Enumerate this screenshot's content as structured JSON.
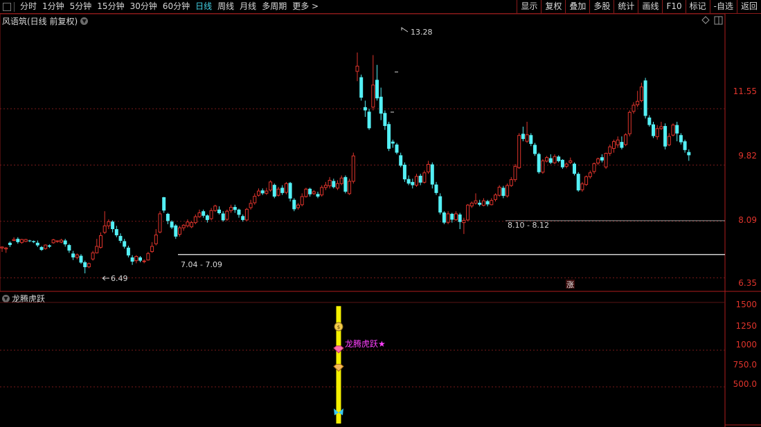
{
  "toolbar": {
    "periods": [
      "分时",
      "1分钟",
      "5分钟",
      "15分钟",
      "30分钟",
      "60分钟",
      "日线",
      "周线",
      "月线",
      "多周期",
      "更多 >"
    ],
    "active_period": "日线",
    "right_buttons": [
      "显示",
      "复权",
      "叠加",
      "多股",
      "统计",
      "画线",
      "F10",
      "标记",
      "-自选",
      "返回"
    ]
  },
  "main_panel": {
    "title": "风语筑(日线 前复权)",
    "axis_labels": [
      "11.55",
      "9.82",
      "8.09",
      "6.35"
    ],
    "annotations": {
      "high": "13.28",
      "low": "6.49",
      "support_left": "7.04 - 7.09",
      "support_right": "8.10 - 8.12",
      "zhang_marker": "涨"
    }
  },
  "indicator_panel": {
    "title": "龙腾虎跃",
    "axis_labels": [
      "1500",
      "1250",
      "1000",
      "750.0",
      "500.0"
    ],
    "signal_label": "龙腾虎跃★"
  },
  "colors": {
    "up": "#e0342c",
    "down": "#54f0f5",
    "background": "#000000",
    "grid": "#7a1a1a",
    "indicator_bar": "#f5f000",
    "signal_text": "#ff40ff"
  },
  "chart_data": {
    "type": "candlestick",
    "ylim": [
      6.0,
      14.0
    ],
    "candles": [
      [
        7.27,
        7.3,
        7.32,
        7.15
      ],
      [
        7.24,
        7.27,
        7.3,
        7.12
      ],
      [
        7.43,
        7.36,
        7.47,
        7.3
      ],
      [
        7.5,
        7.53,
        7.6,
        7.48
      ],
      [
        7.55,
        7.45,
        7.6,
        7.4
      ],
      [
        7.44,
        7.53,
        7.55,
        7.4
      ],
      [
        7.47,
        7.53,
        7.55,
        7.45
      ],
      [
        7.5,
        7.49,
        7.52,
        7.45
      ],
      [
        7.48,
        7.45,
        7.5,
        7.42
      ],
      [
        7.43,
        7.35,
        7.5,
        7.3
      ],
      [
        7.3,
        7.21,
        7.33,
        7.18
      ],
      [
        7.25,
        7.36,
        7.38,
        7.22
      ],
      [
        7.35,
        7.31,
        7.38,
        7.27
      ],
      [
        7.43,
        7.52,
        7.55,
        7.4
      ],
      [
        7.47,
        7.49,
        7.5,
        7.43
      ],
      [
        7.45,
        7.51,
        7.55,
        7.42
      ],
      [
        7.5,
        7.38,
        7.55,
        7.31
      ],
      [
        7.36,
        7.19,
        7.4,
        7.12
      ],
      [
        7.1,
        6.98,
        7.18,
        6.9
      ],
      [
        6.98,
        7.06,
        7.1,
        6.92
      ],
      [
        7.03,
        6.82,
        7.08,
        6.78
      ],
      [
        6.83,
        6.68,
        6.88,
        6.49
      ],
      [
        6.69,
        6.79,
        6.82,
        6.65
      ],
      [
        6.93,
        7.12,
        7.18,
        6.88
      ],
      [
        7.12,
        7.32,
        7.55,
        7.1
      ],
      [
        7.29,
        7.65,
        7.75,
        7.25
      ],
      [
        7.75,
        7.95,
        8.4,
        7.7
      ],
      [
        7.95,
        8.08,
        8.15,
        7.85
      ],
      [
        8.08,
        7.85,
        8.12,
        7.75
      ],
      [
        7.85,
        7.66,
        7.95,
        7.6
      ],
      [
        7.64,
        7.49,
        7.72,
        7.42
      ],
      [
        7.48,
        7.31,
        7.55,
        7.25
      ],
      [
        7.28,
        7.04,
        7.34,
        6.98
      ],
      [
        6.98,
        6.85,
        7.05,
        6.75
      ],
      [
        6.88,
        7.01,
        7.05,
        6.8
      ],
      [
        6.98,
        6.88,
        7.02,
        6.83
      ],
      [
        6.86,
        6.87,
        6.92,
        6.8
      ],
      [
        6.9,
        7.1,
        7.15,
        6.88
      ],
      [
        7.16,
        7.32,
        7.45,
        7.12
      ],
      [
        7.4,
        7.67,
        7.85,
        7.35
      ],
      [
        7.76,
        8.32,
        8.4,
        7.72
      ],
      [
        8.83,
        8.42,
        8.84,
        8.35
      ],
      [
        8.32,
        8.1,
        8.35,
        8.0
      ],
      [
        8.08,
        7.9,
        8.12,
        7.85
      ],
      [
        7.96,
        7.62,
        8.0,
        7.55
      ],
      [
        7.69,
        7.89,
        7.95,
        7.62
      ],
      [
        7.89,
        7.97,
        8.0,
        7.8
      ],
      [
        7.95,
        8.07,
        8.15,
        7.9
      ],
      [
        7.92,
        8.05,
        8.1,
        7.88
      ],
      [
        8.05,
        8.23,
        8.3,
        8.0
      ],
      [
        8.23,
        8.35,
        8.45,
        8.2
      ],
      [
        8.4,
        8.26,
        8.45,
        8.2
      ],
      [
        8.27,
        8.13,
        8.3,
        8.05
      ],
      [
        8.17,
        8.42,
        8.5,
        8.12
      ],
      [
        8.42,
        8.56,
        8.6,
        8.38
      ],
      [
        8.45,
        8.34,
        8.55,
        8.3
      ],
      [
        8.33,
        8.12,
        8.4,
        8.08
      ],
      [
        8.15,
        8.4,
        8.45,
        8.1
      ],
      [
        8.42,
        8.52,
        8.6,
        8.35
      ],
      [
        8.53,
        8.44,
        8.6,
        8.35
      ],
      [
        8.45,
        8.29,
        8.48,
        8.2
      ],
      [
        8.25,
        8.13,
        8.3,
        8.08
      ],
      [
        8.13,
        8.46,
        8.5,
        8.1
      ],
      [
        8.51,
        8.64,
        8.75,
        8.45
      ],
      [
        8.66,
        8.86,
        8.95,
        8.6
      ],
      [
        8.89,
        9.02,
        9.1,
        8.85
      ],
      [
        9.04,
        8.95,
        9.1,
        8.9
      ],
      [
        8.95,
        9.02,
        9.12,
        8.9
      ],
      [
        9.05,
        9.3,
        9.35,
        9.0
      ],
      [
        9.21,
        8.85,
        9.25,
        8.8
      ],
      [
        8.89,
        9.08,
        9.15,
        8.85
      ],
      [
        9.12,
        8.96,
        9.2,
        8.9
      ],
      [
        8.98,
        9.25,
        9.3,
        8.92
      ],
      [
        9.27,
        8.79,
        9.3,
        8.7
      ],
      [
        8.75,
        8.46,
        8.8,
        8.4
      ],
      [
        8.51,
        8.59,
        8.65,
        8.45
      ],
      [
        8.6,
        8.85,
        8.95,
        8.55
      ],
      [
        8.85,
        9.08,
        9.12,
        8.82
      ],
      [
        9.09,
        8.92,
        9.12,
        8.85
      ],
      [
        8.94,
        9.0,
        9.05,
        8.9
      ],
      [
        8.93,
        8.85,
        9.0,
        8.8
      ],
      [
        8.9,
        9.13,
        9.2,
        8.85
      ],
      [
        9.13,
        9.2,
        9.3,
        9.05
      ],
      [
        9.18,
        9.35,
        9.45,
        9.1
      ],
      [
        9.33,
        9.14,
        9.4,
        9.1
      ],
      [
        9.11,
        9.25,
        9.35,
        9.05
      ],
      [
        9.25,
        9.42,
        9.5,
        9.2
      ],
      [
        9.45,
        9.0,
        9.5,
        8.95
      ],
      [
        8.94,
        9.32,
        9.4,
        8.9
      ],
      [
        9.32,
        10.1,
        10.2,
        9.25
      ],
      [
        12.7,
        12.86,
        13.28,
        12.4
      ],
      [
        12.52,
        11.89,
        12.6,
        11.8
      ],
      [
        11.6,
        11.5,
        11.8,
        11.3
      ],
      [
        11.46,
        10.95,
        11.55,
        10.9
      ],
      [
        11.6,
        12.28,
        13.2,
        11.5
      ],
      [
        12.44,
        11.87,
        12.9,
        11.8
      ],
      [
        11.92,
        11.4,
        12.2,
        11.2
      ],
      [
        11.42,
        11.02,
        11.5,
        10.9
      ],
      [
        11.08,
        10.32,
        11.15,
        10.25
      ],
      [
        10.54,
        10.48,
        10.6,
        10.35
      ],
      [
        10.45,
        10.2,
        10.5,
        10.15
      ],
      [
        10.12,
        9.8,
        10.2,
        9.75
      ],
      [
        9.83,
        9.38,
        9.9,
        9.3
      ],
      [
        9.39,
        9.25,
        9.5,
        9.2
      ],
      [
        9.3,
        9.2,
        9.4,
        9.1
      ],
      [
        9.2,
        9.47,
        9.55,
        9.15
      ],
      [
        9.49,
        9.28,
        9.55,
        9.2
      ],
      [
        9.29,
        9.58,
        9.65,
        9.25
      ],
      [
        9.61,
        9.84,
        9.95,
        9.55
      ],
      [
        9.84,
        9.22,
        9.9,
        9.1
      ],
      [
        9.22,
        8.96,
        9.3,
        8.9
      ],
      [
        8.86,
        8.36,
        8.95,
        8.3
      ],
      [
        8.36,
        8.05,
        8.4,
        8.0
      ],
      [
        8.06,
        8.32,
        8.4,
        8.0
      ],
      [
        8.32,
        8.14,
        8.35,
        8.05
      ],
      [
        8.14,
        8.32,
        8.4,
        8.1
      ],
      [
        8.3,
        8.07,
        8.35,
        7.85
      ],
      [
        8.05,
        8.12,
        8.2,
        7.7
      ],
      [
        8.13,
        8.59,
        8.62,
        8.1
      ],
      [
        8.56,
        8.65,
        8.7,
        8.5
      ],
      [
        8.65,
        8.72,
        8.95,
        8.6
      ],
      [
        8.66,
        8.6,
        8.75,
        8.55
      ],
      [
        8.58,
        8.72,
        8.8,
        8.55
      ],
      [
        8.71,
        8.61,
        8.75,
        8.55
      ],
      [
        8.6,
        8.73,
        8.8,
        8.58
      ],
      [
        8.76,
        8.9,
        8.95,
        8.7
      ],
      [
        8.89,
        9.14,
        9.2,
        8.85
      ],
      [
        9.12,
        8.87,
        9.18,
        8.8
      ],
      [
        8.87,
        9.19,
        9.25,
        8.82
      ],
      [
        9.19,
        9.37,
        9.45,
        9.15
      ],
      [
        9.37,
        9.78,
        9.85,
        9.3
      ],
      [
        9.74,
        10.73,
        10.8,
        9.7
      ],
      [
        10.78,
        10.62,
        11.0,
        10.55
      ],
      [
        10.55,
        10.75,
        11.15,
        10.5
      ],
      [
        10.74,
        10.47,
        10.8,
        10.4
      ],
      [
        10.44,
        10.16,
        10.5,
        10.1
      ],
      [
        10.16,
        9.6,
        10.2,
        9.55
      ],
      [
        9.6,
        9.95,
        10.0,
        9.55
      ],
      [
        9.94,
        10.05,
        10.1,
        9.9
      ],
      [
        10.03,
        9.89,
        10.15,
        9.85
      ],
      [
        9.89,
        10.08,
        10.15,
        9.85
      ],
      [
        10.08,
        9.94,
        10.12,
        9.9
      ],
      [
        9.98,
        9.75,
        10.0,
        9.7
      ],
      [
        9.78,
        9.85,
        9.9,
        9.72
      ],
      [
        9.9,
        9.95,
        10.05,
        9.85
      ],
      [
        9.86,
        9.55,
        9.9,
        9.5
      ],
      [
        9.55,
        9.04,
        9.6,
        9.0
      ],
      [
        9.06,
        9.24,
        9.3,
        9.0
      ],
      [
        9.22,
        9.46,
        9.5,
        9.18
      ],
      [
        9.46,
        9.58,
        9.65,
        9.4
      ],
      [
        9.62,
        9.86,
        9.9,
        9.55
      ],
      [
        9.88,
        10.01,
        10.05,
        9.82
      ],
      [
        10.06,
        9.96,
        10.15,
        9.9
      ],
      [
        9.76,
        10.18,
        10.2,
        9.7
      ],
      [
        10.18,
        10.38,
        10.45,
        10.1
      ],
      [
        10.33,
        10.54,
        10.6,
        10.2
      ],
      [
        10.44,
        10.59,
        10.7,
        10.35
      ],
      [
        10.53,
        10.35,
        10.7,
        10.3
      ],
      [
        10.45,
        10.75,
        10.8,
        10.4
      ],
      [
        10.78,
        11.44,
        11.5,
        10.7
      ],
      [
        11.47,
        11.66,
        11.75,
        11.4
      ],
      [
        11.67,
        11.78,
        12.1,
        11.6
      ],
      [
        11.8,
        12.22,
        12.35,
        11.75
      ],
      [
        12.42,
        11.33,
        12.5,
        11.25
      ],
      [
        11.28,
        11.05,
        11.35,
        11.0
      ],
      [
        11.07,
        10.71,
        11.15,
        10.65
      ],
      [
        10.69,
        10.94,
        11.05,
        10.6
      ],
      [
        10.94,
        11.0,
        11.15,
        10.9
      ],
      [
        11.02,
        10.39,
        11.1,
        10.3
      ],
      [
        10.44,
        10.7,
        10.8,
        10.4
      ],
      [
        10.74,
        11.05,
        11.1,
        10.7
      ],
      [
        11.05,
        10.79,
        11.15,
        10.55
      ],
      [
        10.74,
        10.52,
        10.8,
        10.45
      ],
      [
        10.55,
        10.28,
        10.6,
        10.2
      ],
      [
        10.22,
        10.12,
        10.3,
        9.95
      ]
    ],
    "support_levels": [
      {
        "label": "7.04 - 7.09",
        "value": 7.07
      },
      {
        "label": "8.10 - 8.12",
        "value": 8.11
      }
    ],
    "indicator": {
      "name": "龙腾虎跃",
      "ylim": [
        0,
        1650
      ],
      "bar_index": 92,
      "bar_range": [
        0,
        1600
      ],
      "markers": [
        {
          "icon": "money-bag-icon",
          "value": 1320
        },
        {
          "icon": "ruby-gem-icon",
          "value": 1010
        },
        {
          "icon": "gold-gem-icon",
          "value": 760
        },
        {
          "icon": "butterfly-icon",
          "value": 150
        }
      ]
    }
  }
}
